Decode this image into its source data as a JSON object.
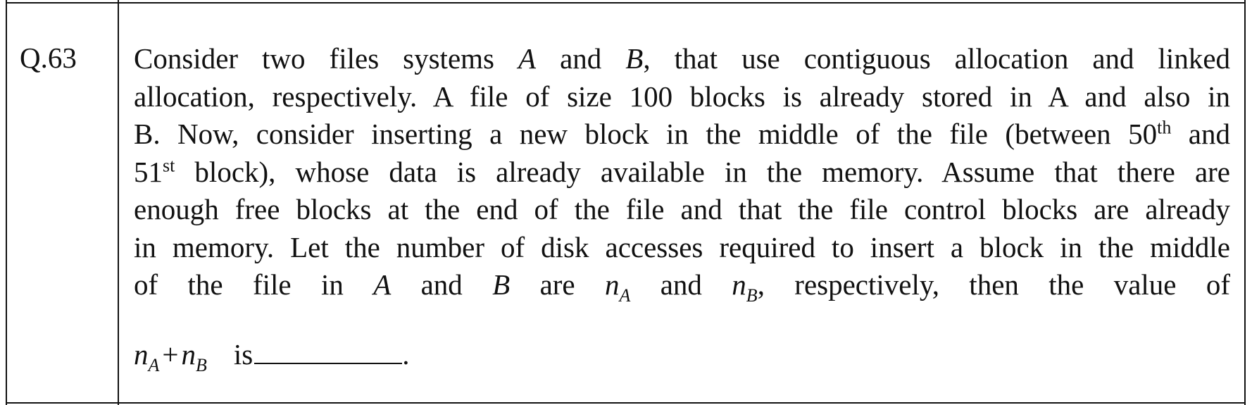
{
  "question": {
    "number": "Q.63",
    "lines": [
      [
        "Consider two files systems ",
        "A",
        " and ",
        "B",
        ", that use contiguous allocation and linked"
      ],
      [
        "allocation, respectively. A file of size 100 blocks is already stored in A and also in"
      ],
      [
        "B. Now, consider inserting a new block in the middle of the file (between 50",
        "th",
        " and"
      ],
      [
        "51",
        "st",
        " block), whose data is already available in the memory. Assume that there are"
      ],
      [
        "enough free blocks at the end of the file and that the file control blocks are already"
      ],
      [
        "in memory. Let the number of disk accesses required to insert a block in the middle"
      ],
      [
        "of the file in ",
        "A",
        " and ",
        "B",
        " are ",
        "n",
        "A",
        " and ",
        "n",
        "B",
        ", respectively, then the value of"
      ]
    ],
    "formula": {
      "n": "n",
      "sub_a": "A",
      "plus": "+",
      "sub_b": "B",
      "is": "is",
      "end": "."
    }
  }
}
